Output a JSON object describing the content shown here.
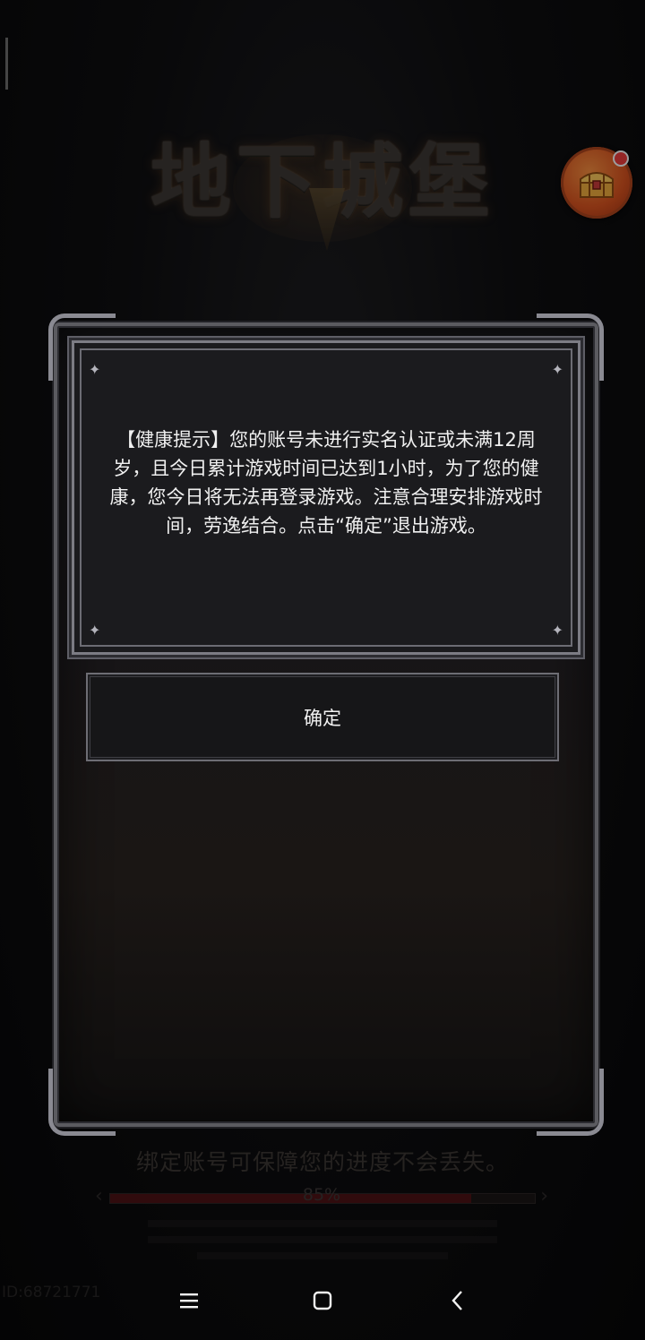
{
  "game": {
    "logo_text": "地下城堡"
  },
  "dialog": {
    "message": "【健康提示】您的账号未进行实名认证或未满12周岁，且今日累计游戏时间已达到1小时，为了您的健康，您今日将无法再登录游戏。注意合理安排游戏时间，劳逸结合。点击“确定”退出游戏。",
    "confirm_label": "确定"
  },
  "background": {
    "bind_tip": "绑定账号可保障您的进度不会丢失。",
    "progress": {
      "value": 85,
      "label": "85%"
    },
    "user_id": "ID:68721771"
  },
  "colors": {
    "accent": "#d4521f",
    "notification_dot": "#e53b3b",
    "progress_fill": "#4a1214"
  },
  "icons": [
    "treasure-chest-icon",
    "notification-dot",
    "menu-icon",
    "home-icon",
    "back-icon"
  ]
}
